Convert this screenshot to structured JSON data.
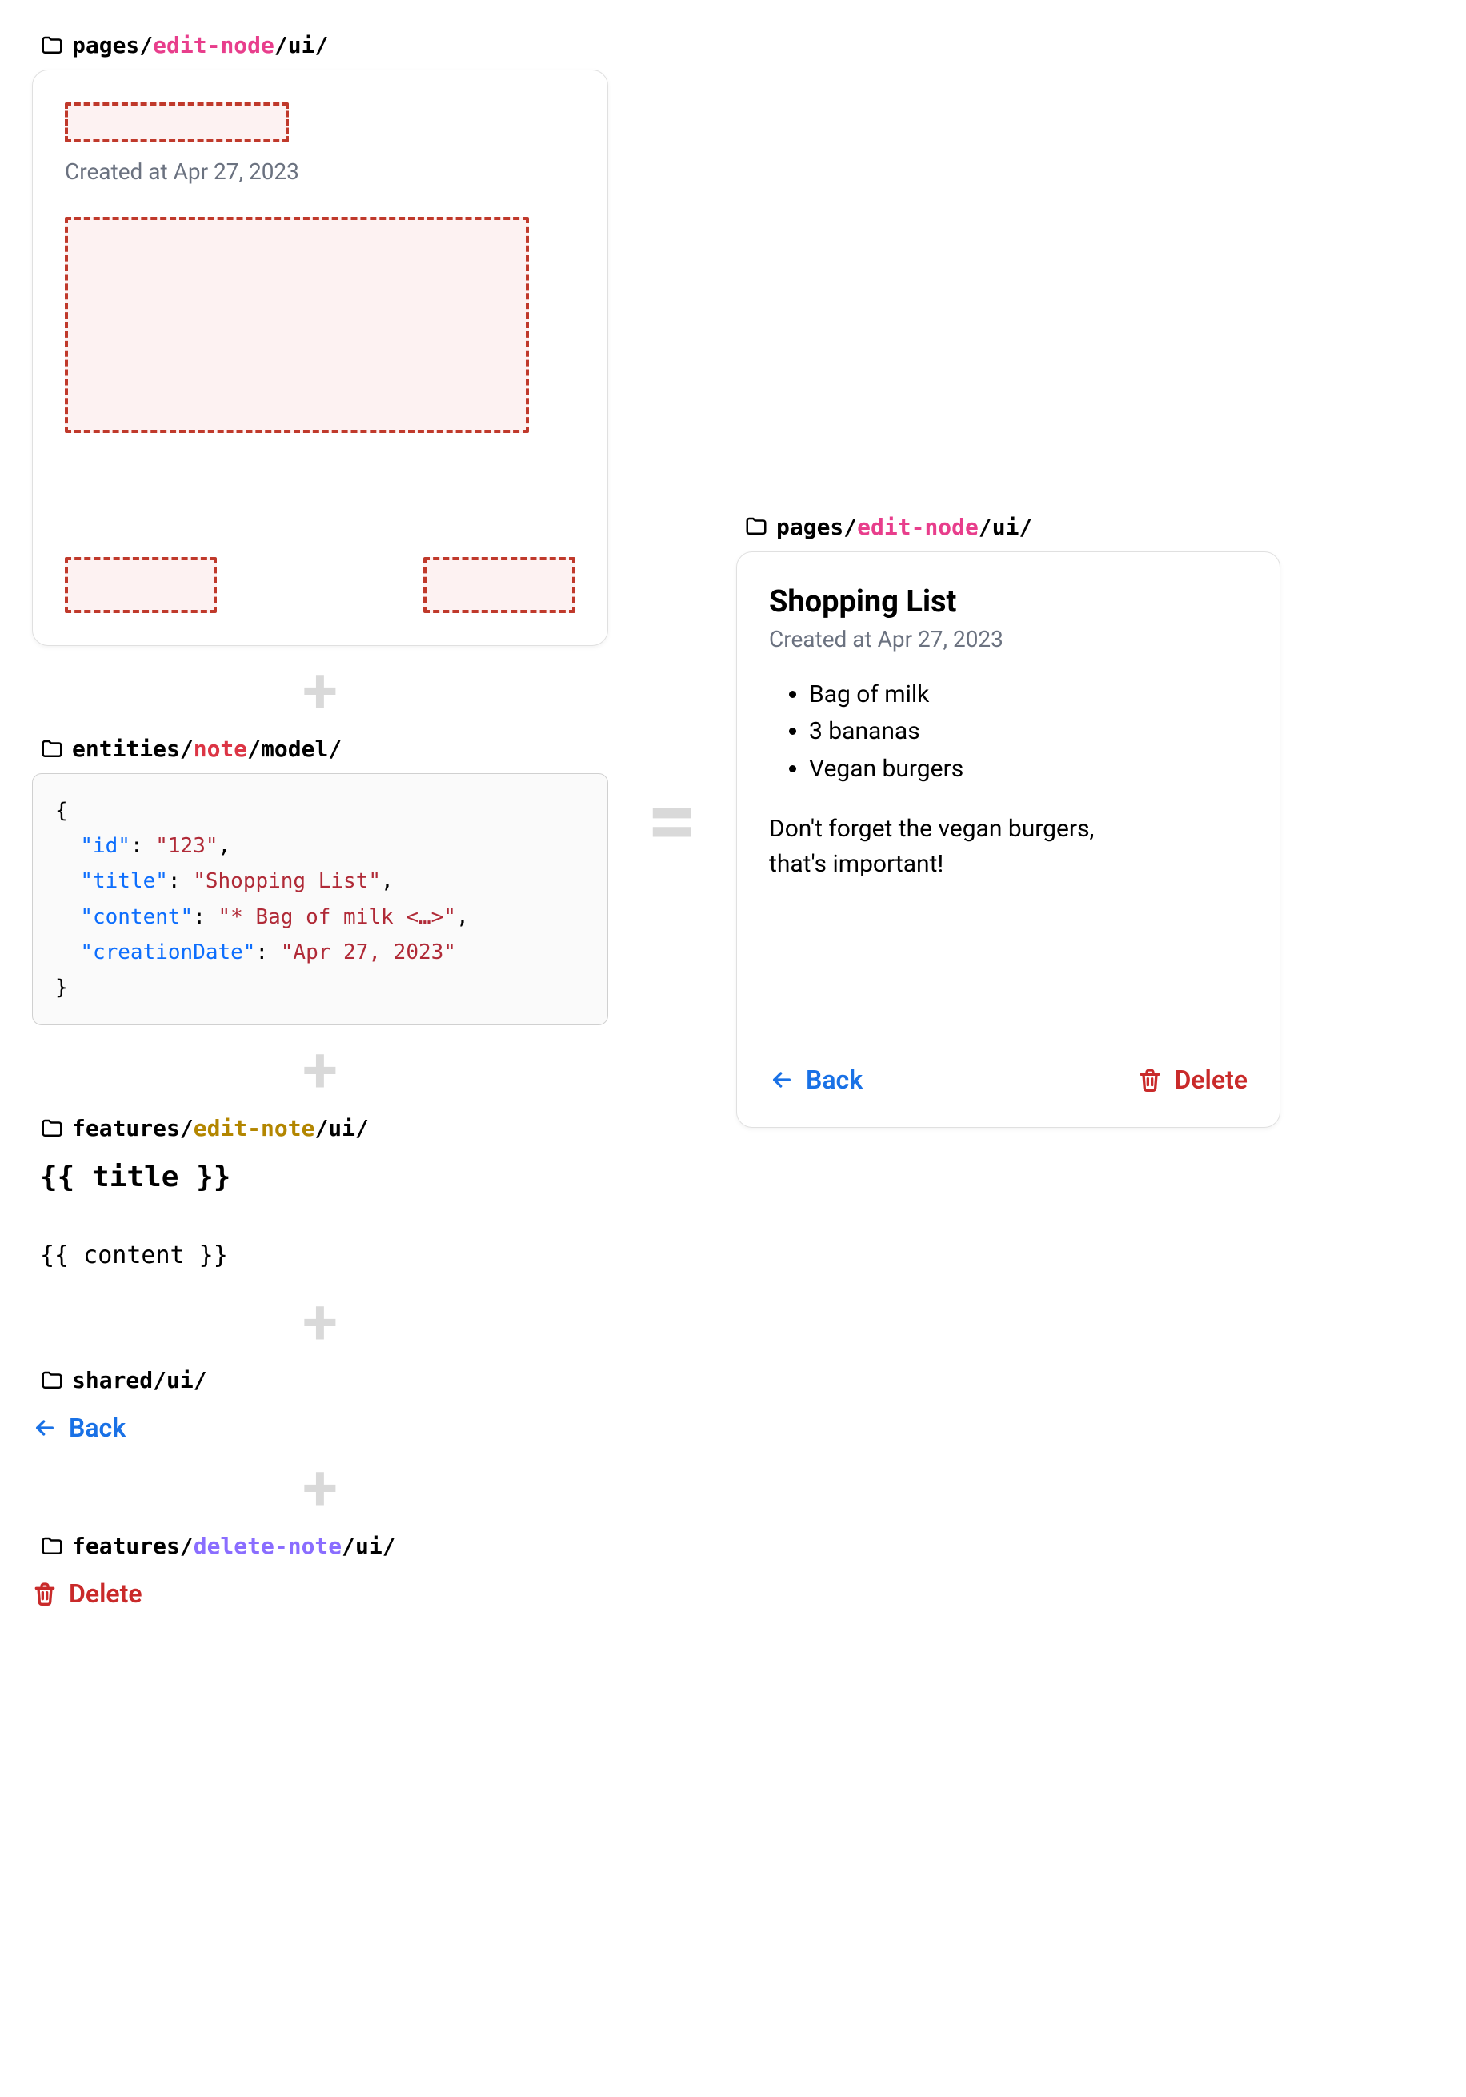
{
  "left": {
    "pages": {
      "path_parts": [
        "pages/",
        "edit-node",
        "/ui/"
      ],
      "created_at": "Created at Apr 27, 2023"
    },
    "entities": {
      "path_parts": [
        "entities/",
        "note",
        "/model/"
      ],
      "json": {
        "id_key": "\"id\"",
        "id_val": "\"123\"",
        "title_key": "\"title\"",
        "title_val": "\"Shopping List\"",
        "content_key": "\"content\"",
        "content_val": "\"* Bag of milk <…>\"",
        "date_key": "\"creationDate\"",
        "date_val": "\"Apr 27, 2023\""
      }
    },
    "edit_feature": {
      "path_parts": [
        "features/",
        "edit-note",
        "/ui/"
      ],
      "tpl_title": "{{ title }}",
      "tpl_content": "{{ content }}"
    },
    "shared": {
      "path_parts": [
        "shared/",
        "ui/"
      ],
      "back_label": "Back"
    },
    "delete_feature": {
      "path_parts": [
        "features/",
        "delete-note",
        "/ui/"
      ],
      "delete_label": "Delete"
    }
  },
  "right": {
    "path_parts": [
      "pages/",
      "edit-node",
      "/ui/"
    ],
    "title": "Shopping List",
    "created_at": "Created at Apr 27, 2023",
    "items": [
      "Bag of milk",
      "3 bananas",
      "Vegan burgers"
    ],
    "note_line1": "Don't forget the vegan burgers,",
    "note_line2": "that's important!",
    "back_label": "Back",
    "delete_label": "Delete"
  }
}
